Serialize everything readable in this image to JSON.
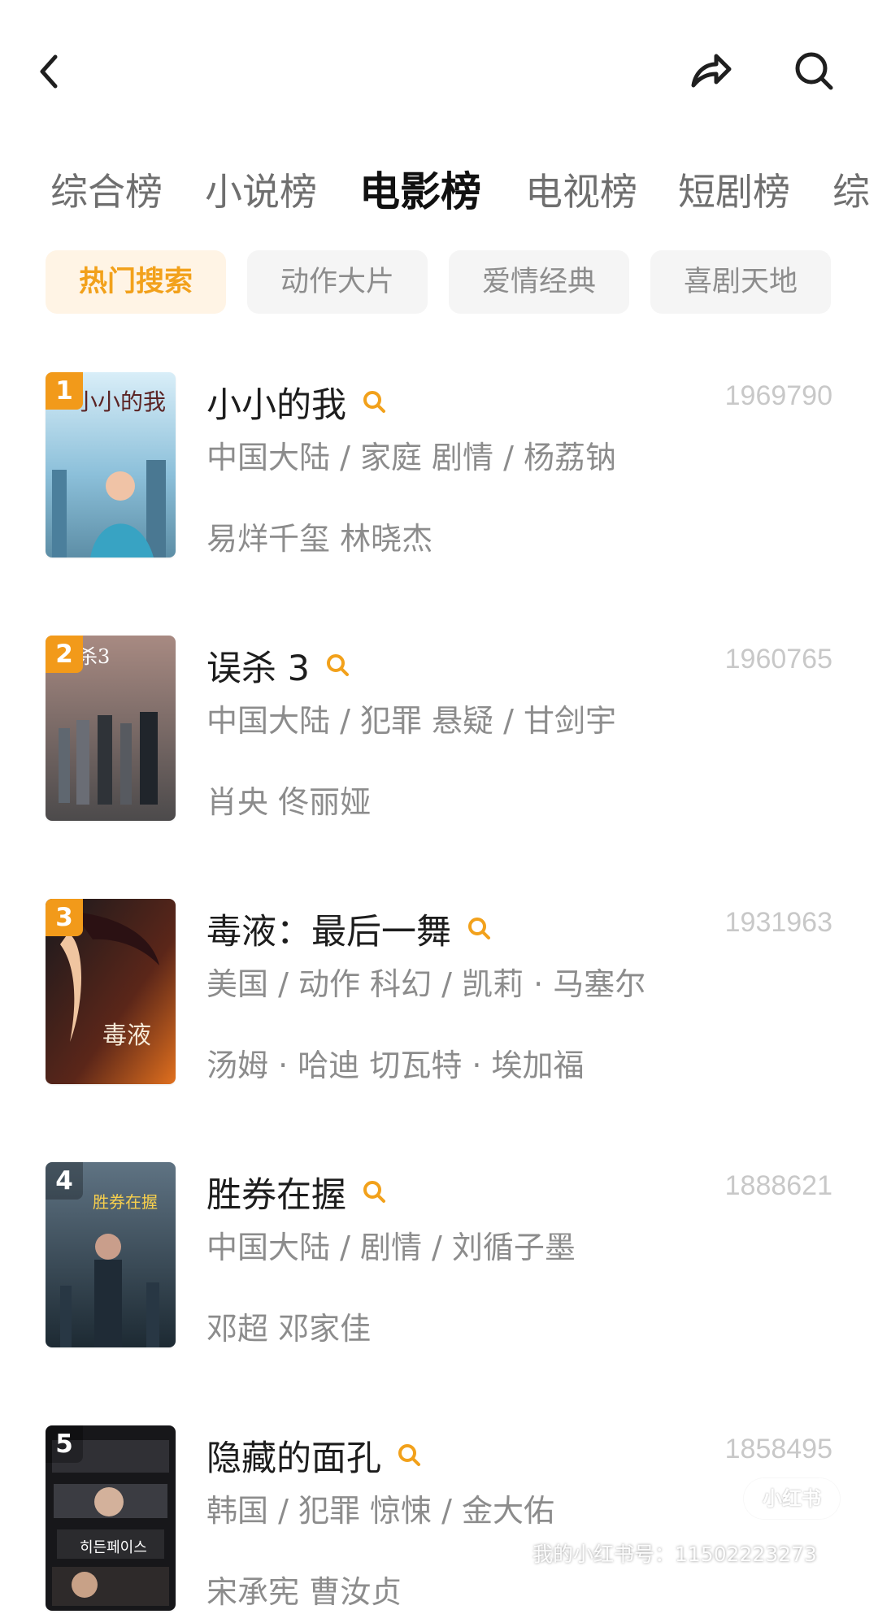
{
  "topbar": {
    "back_icon": "chevron-left-icon",
    "share_icon": "share-arrow-icon",
    "search_icon": "search-icon"
  },
  "tabs": [
    {
      "label": "综合榜",
      "active": false
    },
    {
      "label": "小说榜",
      "active": false
    },
    {
      "label": "电影榜",
      "active": true
    },
    {
      "label": "电视榜",
      "active": false
    },
    {
      "label": "短剧榜",
      "active": false
    },
    {
      "label": "综",
      "active": false
    }
  ],
  "chips": [
    {
      "label": "热门搜索",
      "active": true
    },
    {
      "label": "动作大片",
      "active": false
    },
    {
      "label": "爱情经典",
      "active": false
    },
    {
      "label": "喜剧天地",
      "active": false
    }
  ],
  "movies": [
    {
      "rank": "1",
      "title": "小小的我",
      "count": "1969790",
      "meta": "中国大陆 / 家庭 剧情 / 杨荔钠",
      "cast": "易烊千玺 林晓杰",
      "poster_text": "小小的我"
    },
    {
      "rank": "2",
      "title": "误杀 3",
      "count": "1960765",
      "meta": "中国大陆 / 犯罪 悬疑 / 甘剑宇",
      "cast": "肖央 佟丽娅",
      "poster_text": "误杀3"
    },
    {
      "rank": "3",
      "title": "毒液：最后一舞",
      "count": "1931963",
      "meta": "美国 / 动作 科幻 / 凯莉 · 马塞尔",
      "cast": "汤姆 · 哈迪    切瓦特 · 埃加福",
      "poster_text": "毒液"
    },
    {
      "rank": "4",
      "title": "胜券在握",
      "count": "1888621",
      "meta": "中国大陆 / 剧情 / 刘循子墨",
      "cast": "邓超 邓家佳",
      "poster_text": "胜券在握"
    },
    {
      "rank": "5",
      "title": "隐藏的面孔",
      "count": "1858495",
      "meta": "韩国 / 犯罪 惊悚 / 金大佑",
      "cast": "宋承宪 曹汝贞",
      "poster_text": "히든페이스"
    }
  ],
  "watermark": {
    "text": "我的小红书号：11502223273",
    "badge": "小红书"
  }
}
